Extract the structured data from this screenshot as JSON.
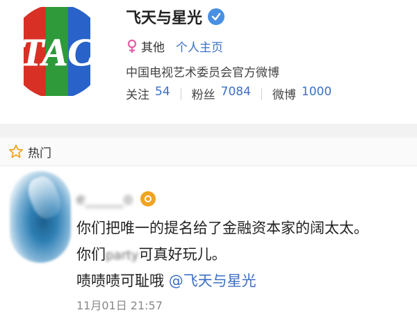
{
  "profile": {
    "name": "飞天与星光",
    "gender": "其他",
    "homepage_link": "个人主页",
    "description": "中国电视艺术委员会官方微博",
    "avatar_text": "TAC",
    "stats": [
      {
        "label": "关注",
        "value": "54"
      },
      {
        "label": "粉丝",
        "value": "7084"
      },
      {
        "label": "微博",
        "value": "1000"
      }
    ]
  },
  "hot_section": {
    "title": "热门"
  },
  "post": {
    "author": "e_____o",
    "text_line1": "你们把唯一的提名给了金融资本家的阔太太。",
    "text_line2_a": "你们",
    "text_line2_blur": "party",
    "text_line2_b": "可真好玩儿。",
    "text_line3": "啧啧啧可耻哦 ",
    "mention": "@飞天与星光",
    "timestamp": "11月01日 21:57"
  },
  "colors": {
    "link": "#3c6fc4",
    "verified": "#4a90e2",
    "vip": "#f0a323"
  }
}
